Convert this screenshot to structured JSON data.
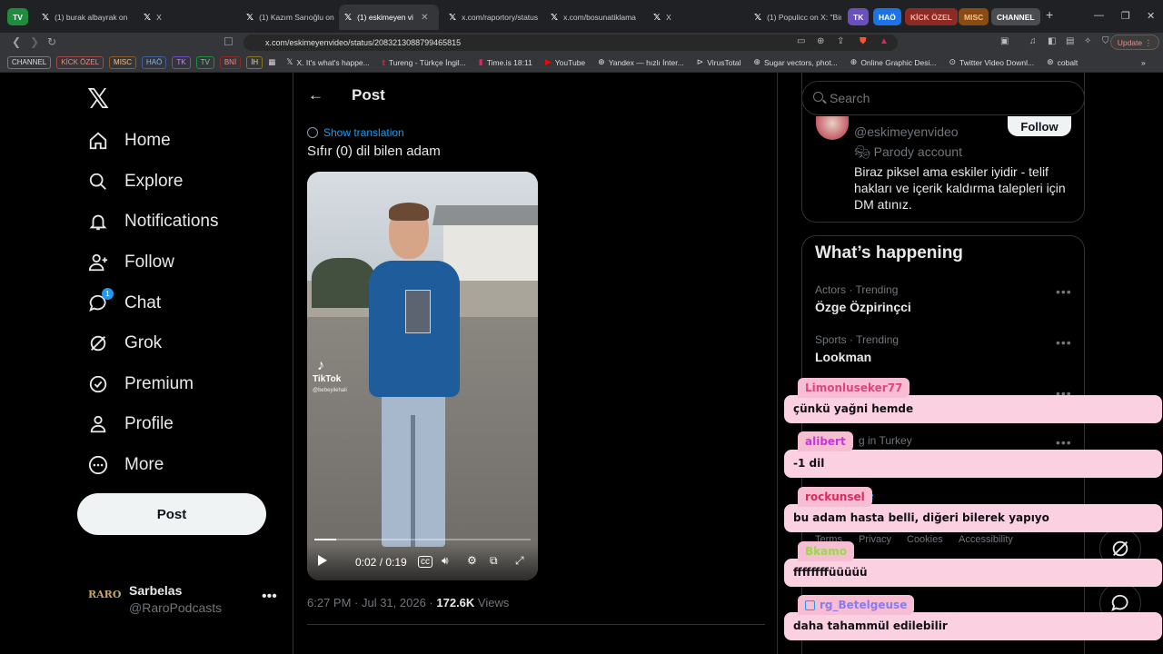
{
  "browser": {
    "tab_groups": [
      {
        "label": "TV",
        "color": "#1e8e3e"
      },
      {
        "label": "TK",
        "color": "#6a4fbf"
      },
      {
        "label": "HAÖ",
        "color": "#1a73e8"
      },
      {
        "label": "KİCK ÖZEL",
        "color": "#d93025"
      },
      {
        "label": "MISC",
        "color": "#e8710a"
      },
      {
        "label": "CHANNEL",
        "color": "#5f6368"
      }
    ],
    "tabs": [
      {
        "title": "(1) burak albayrak on X"
      },
      {
        "title": "X"
      },
      {
        "title": "(1) Kazım Sarıoğlu on"
      },
      {
        "title": "(1) eskimeyen video"
      },
      {
        "title": "x.com/raportory/status"
      },
      {
        "title": "x.com/bosunatiklama"
      },
      {
        "title": "X"
      },
      {
        "title": "(1) Populicc on X: \"Bir"
      }
    ],
    "new_tab": "+",
    "url": "x.com/eskimeyenvideo/status/2083213088799465815",
    "update_label": "Update",
    "bookmark_chips": [
      "CHANNEL",
      "KİCK ÖZEL",
      "MISC",
      "HAÖ",
      "TK",
      "TV",
      "BNİ",
      "İH"
    ],
    "bookmarks": [
      {
        "label": "X. It's what's happe..."
      },
      {
        "label": "Tureng - Türkçe İngil..."
      },
      {
        "label": "Time.is 18:11"
      },
      {
        "label": "YouTube"
      },
      {
        "label": "Yandex — hızlı İnter..."
      },
      {
        "label": "VirusTotal"
      },
      {
        "label": "Sugar vectors, phot..."
      },
      {
        "label": "Online Graphic Desi..."
      },
      {
        "label": "Twitter Video Downl..."
      },
      {
        "label": "cobalt"
      }
    ]
  },
  "nav": {
    "items": [
      {
        "label": "Home"
      },
      {
        "label": "Explore"
      },
      {
        "label": "Notifications"
      },
      {
        "label": "Follow"
      },
      {
        "label": "Chat",
        "badge": "1"
      },
      {
        "label": "Grok"
      },
      {
        "label": "Premium"
      },
      {
        "label": "Profile"
      },
      {
        "label": "More"
      }
    ],
    "post_button": "Post",
    "account": {
      "name": "Sarbelas",
      "handle": "@RaroPodcasts",
      "avatar_text": "RARO"
    }
  },
  "post": {
    "header": "Post",
    "show_translation": "Show translation",
    "text": "Sıfır (0) dil bilen adam",
    "video": {
      "time": "0:02 / 0:19",
      "progress": 0.1,
      "tiktok_label": "TikTok",
      "tiktok_handle": "@bebeyilehali"
    },
    "timestamp": "6:27 PM · Jul 31, 2026",
    "views_count": "172.6K",
    "views_label": "Views"
  },
  "right": {
    "search_placeholder": "Search",
    "relevant": {
      "handle": "@eskimeyenvideo",
      "parody": "Parody account",
      "bio": "Biraz piksel ama eskiler iyidir - telif hakları ve içerik kaldırma talepleri için DM atınız.",
      "follow_label": "Follow"
    },
    "happening_title": "What’s happening",
    "trends": [
      {
        "category": "Actors · Trending",
        "name": "Özge Özpirinçci"
      },
      {
        "category": "Sports · Trending",
        "name": "Lookman"
      }
    ],
    "partial_texts": {
      "trending_turkey": "g in Turkey",
      "more_link": "re",
      "footer_terms": "Terms",
      "footer_privacy": "Privacy",
      "footer_cookies": "Cookies",
      "footer_accessibility": "Accessibility"
    }
  },
  "chat": [
    {
      "user": "Limonluseker77",
      "color": "#e0457b",
      "message": "çünkü yağni hemde"
    },
    {
      "user": "alibert",
      "color": "#c238d9",
      "message": "-1 dil"
    },
    {
      "user": "rockunsel",
      "color": "#d92c5c",
      "message": "bu adam hasta belli, diğeri bilerek yapıyo"
    },
    {
      "user": "Bkamo",
      "color": "#9ad94a",
      "message": "ffffffffüüüüü"
    },
    {
      "user": "rg_Betelgeuse",
      "color": "#8a7bf0",
      "message": "daha tahammül edilebilir"
    }
  ]
}
